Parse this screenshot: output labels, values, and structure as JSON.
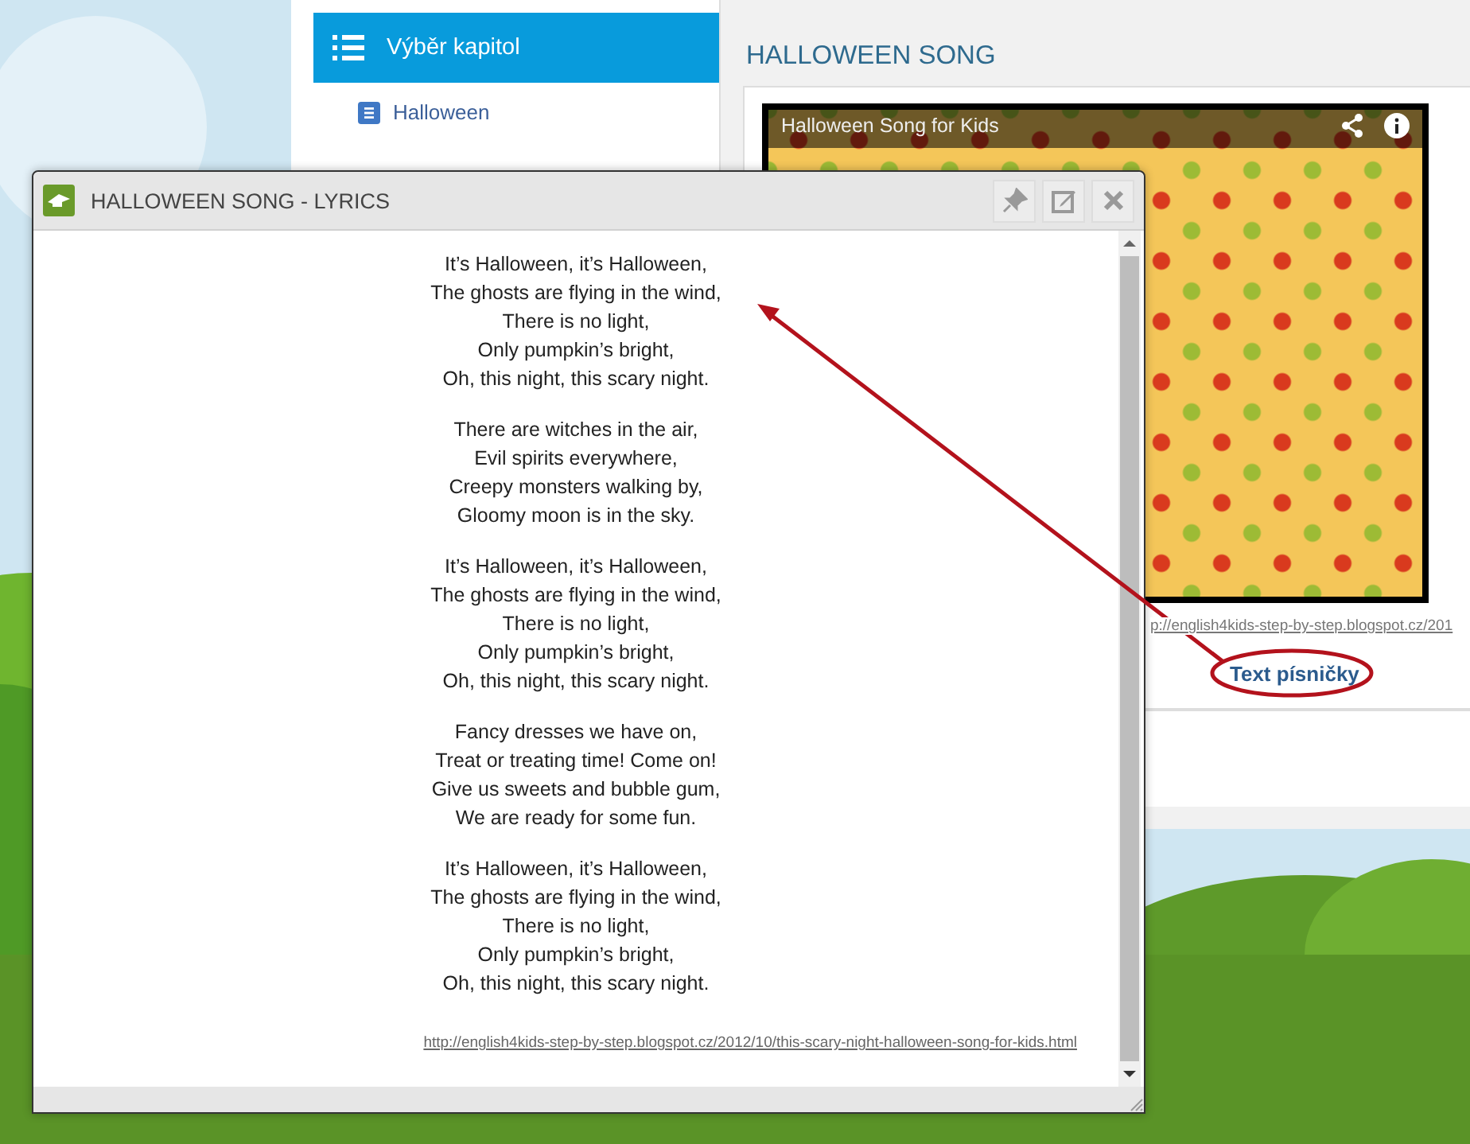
{
  "sidebar": {
    "header": "Výběr kapitol",
    "items": [
      {
        "label": "Halloween"
      }
    ]
  },
  "content": {
    "title": "HALLOWEEN SONG",
    "video": {
      "title": "Halloween Song for Kids"
    },
    "source_link": "p://english4kids-step-by-step.blogspot.cz/201",
    "lyrics_link": "Text písničky"
  },
  "dialog": {
    "title": "HALLOWEEN SONG - LYRICS",
    "stanzas": [
      [
        "It’s Halloween, it’s Halloween,",
        "The ghosts are flying in the wind,",
        "There is no light,",
        "Only pumpkin’s bright,",
        "Oh, this night, this scary night."
      ],
      [
        "There are witches in the air,",
        "Evil spirits everywhere,",
        "Creepy monsters walking by,",
        "Gloomy moon is in the sky."
      ],
      [
        "It’s Halloween, it’s Halloween,",
        "The ghosts are flying in the wind,",
        "There is no light,",
        "Only pumpkin’s bright,",
        "Oh, this night, this scary night."
      ],
      [
        "Fancy dresses we have on,",
        "Treat or treating time! Come on!",
        "Give us sweets and bubble gum,",
        "We are ready for some fun."
      ],
      [
        "It’s Halloween, it’s Halloween,",
        "The ghosts are flying in the wind,",
        "There is no light,",
        "Only pumpkin’s bright,",
        "Oh, this night, this scary night."
      ]
    ],
    "source_link": "http://english4kids-step-by-step.blogspot.cz/2012/10/this-scary-night-halloween-song-for-kids.html"
  }
}
